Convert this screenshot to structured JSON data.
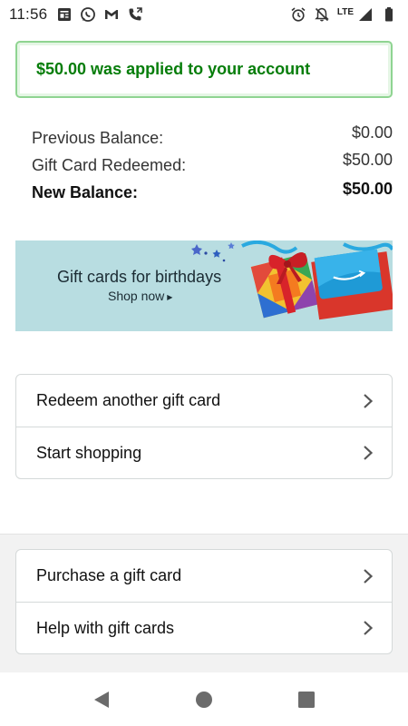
{
  "status_bar": {
    "time": "11:56",
    "network": "LTE",
    "left_icons": [
      "news-icon",
      "whatsapp-icon",
      "gmail-icon",
      "call-forward-icon"
    ],
    "right_icons": [
      "alarm-icon",
      "notifications-off-icon",
      "signal-icon",
      "battery-icon"
    ]
  },
  "banner": {
    "message": "$50.00 was applied to your account",
    "color": "#067d0a",
    "border_color": "#8fd491"
  },
  "balance": {
    "previous_label": "Previous Balance:",
    "previous_value": "$0.00",
    "redeemed_label": "Gift Card Redeemed:",
    "redeemed_value": "$50.00",
    "new_label": "New Balance:",
    "new_value": "$50.00"
  },
  "promo": {
    "title": "Gift cards for birthdays",
    "cta": "Shop now",
    "background": "#b8dde1"
  },
  "actions_primary": [
    {
      "label": "Redeem another gift card"
    },
    {
      "label": "Start shopping"
    }
  ],
  "actions_secondary": [
    {
      "label": "Purchase a gift card"
    },
    {
      "label": "Help with gift cards"
    }
  ],
  "nav": {
    "icons": [
      "back-icon",
      "home-icon",
      "recents-icon"
    ]
  }
}
